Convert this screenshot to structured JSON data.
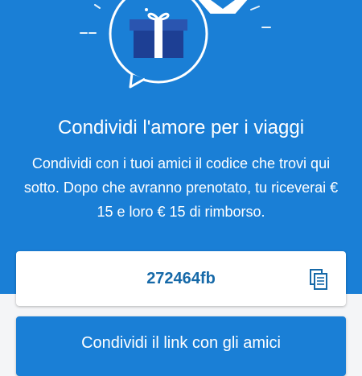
{
  "colors": {
    "brand": "#1a7fd6",
    "code_text": "#1669a8",
    "gift_dark": "#1d3f94"
  },
  "icons": {
    "illustration": "gift-speech-bubble-icon",
    "copy": "copy-icon"
  },
  "referral": {
    "title": "Condividi l'amore per i viaggi",
    "description": "Condividi con i tuoi amici il codice che trovi qui sotto. Dopo che avranno prenotato, tu riceverai € 15 e loro € 15 di rimborso.",
    "code": "272464fb",
    "share_label": "Condividi il link con gli amici"
  }
}
